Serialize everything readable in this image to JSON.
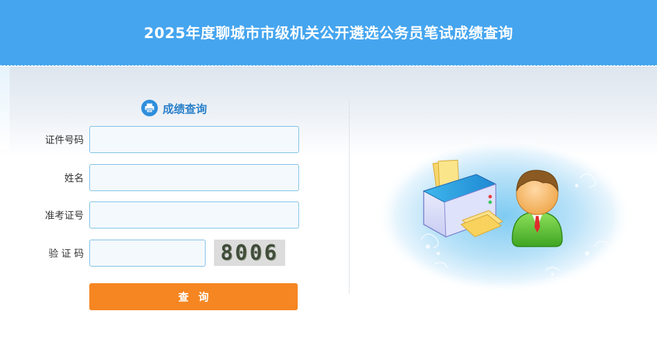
{
  "header": {
    "title": "2025年度聊城市市级机关公开遴选公务员笔试成绩查询"
  },
  "form": {
    "section_title": "成绩查询",
    "fields": [
      {
        "label": "证件号码",
        "value": "",
        "placeholder": ""
      },
      {
        "label": "姓名",
        "value": "",
        "placeholder": ""
      },
      {
        "label": "准考证号",
        "value": "",
        "placeholder": ""
      },
      {
        "label": "验 证 码",
        "value": "",
        "placeholder": ""
      }
    ],
    "captcha_text": "8006",
    "submit_label": "查询"
  },
  "icons": {
    "section": "printer-icon",
    "illustration": "printer-and-person-illustration"
  },
  "colors": {
    "header": "#45a5ef",
    "accent": "#2a7fc9",
    "button": "#f58622",
    "input_border": "#7ec2e5"
  }
}
